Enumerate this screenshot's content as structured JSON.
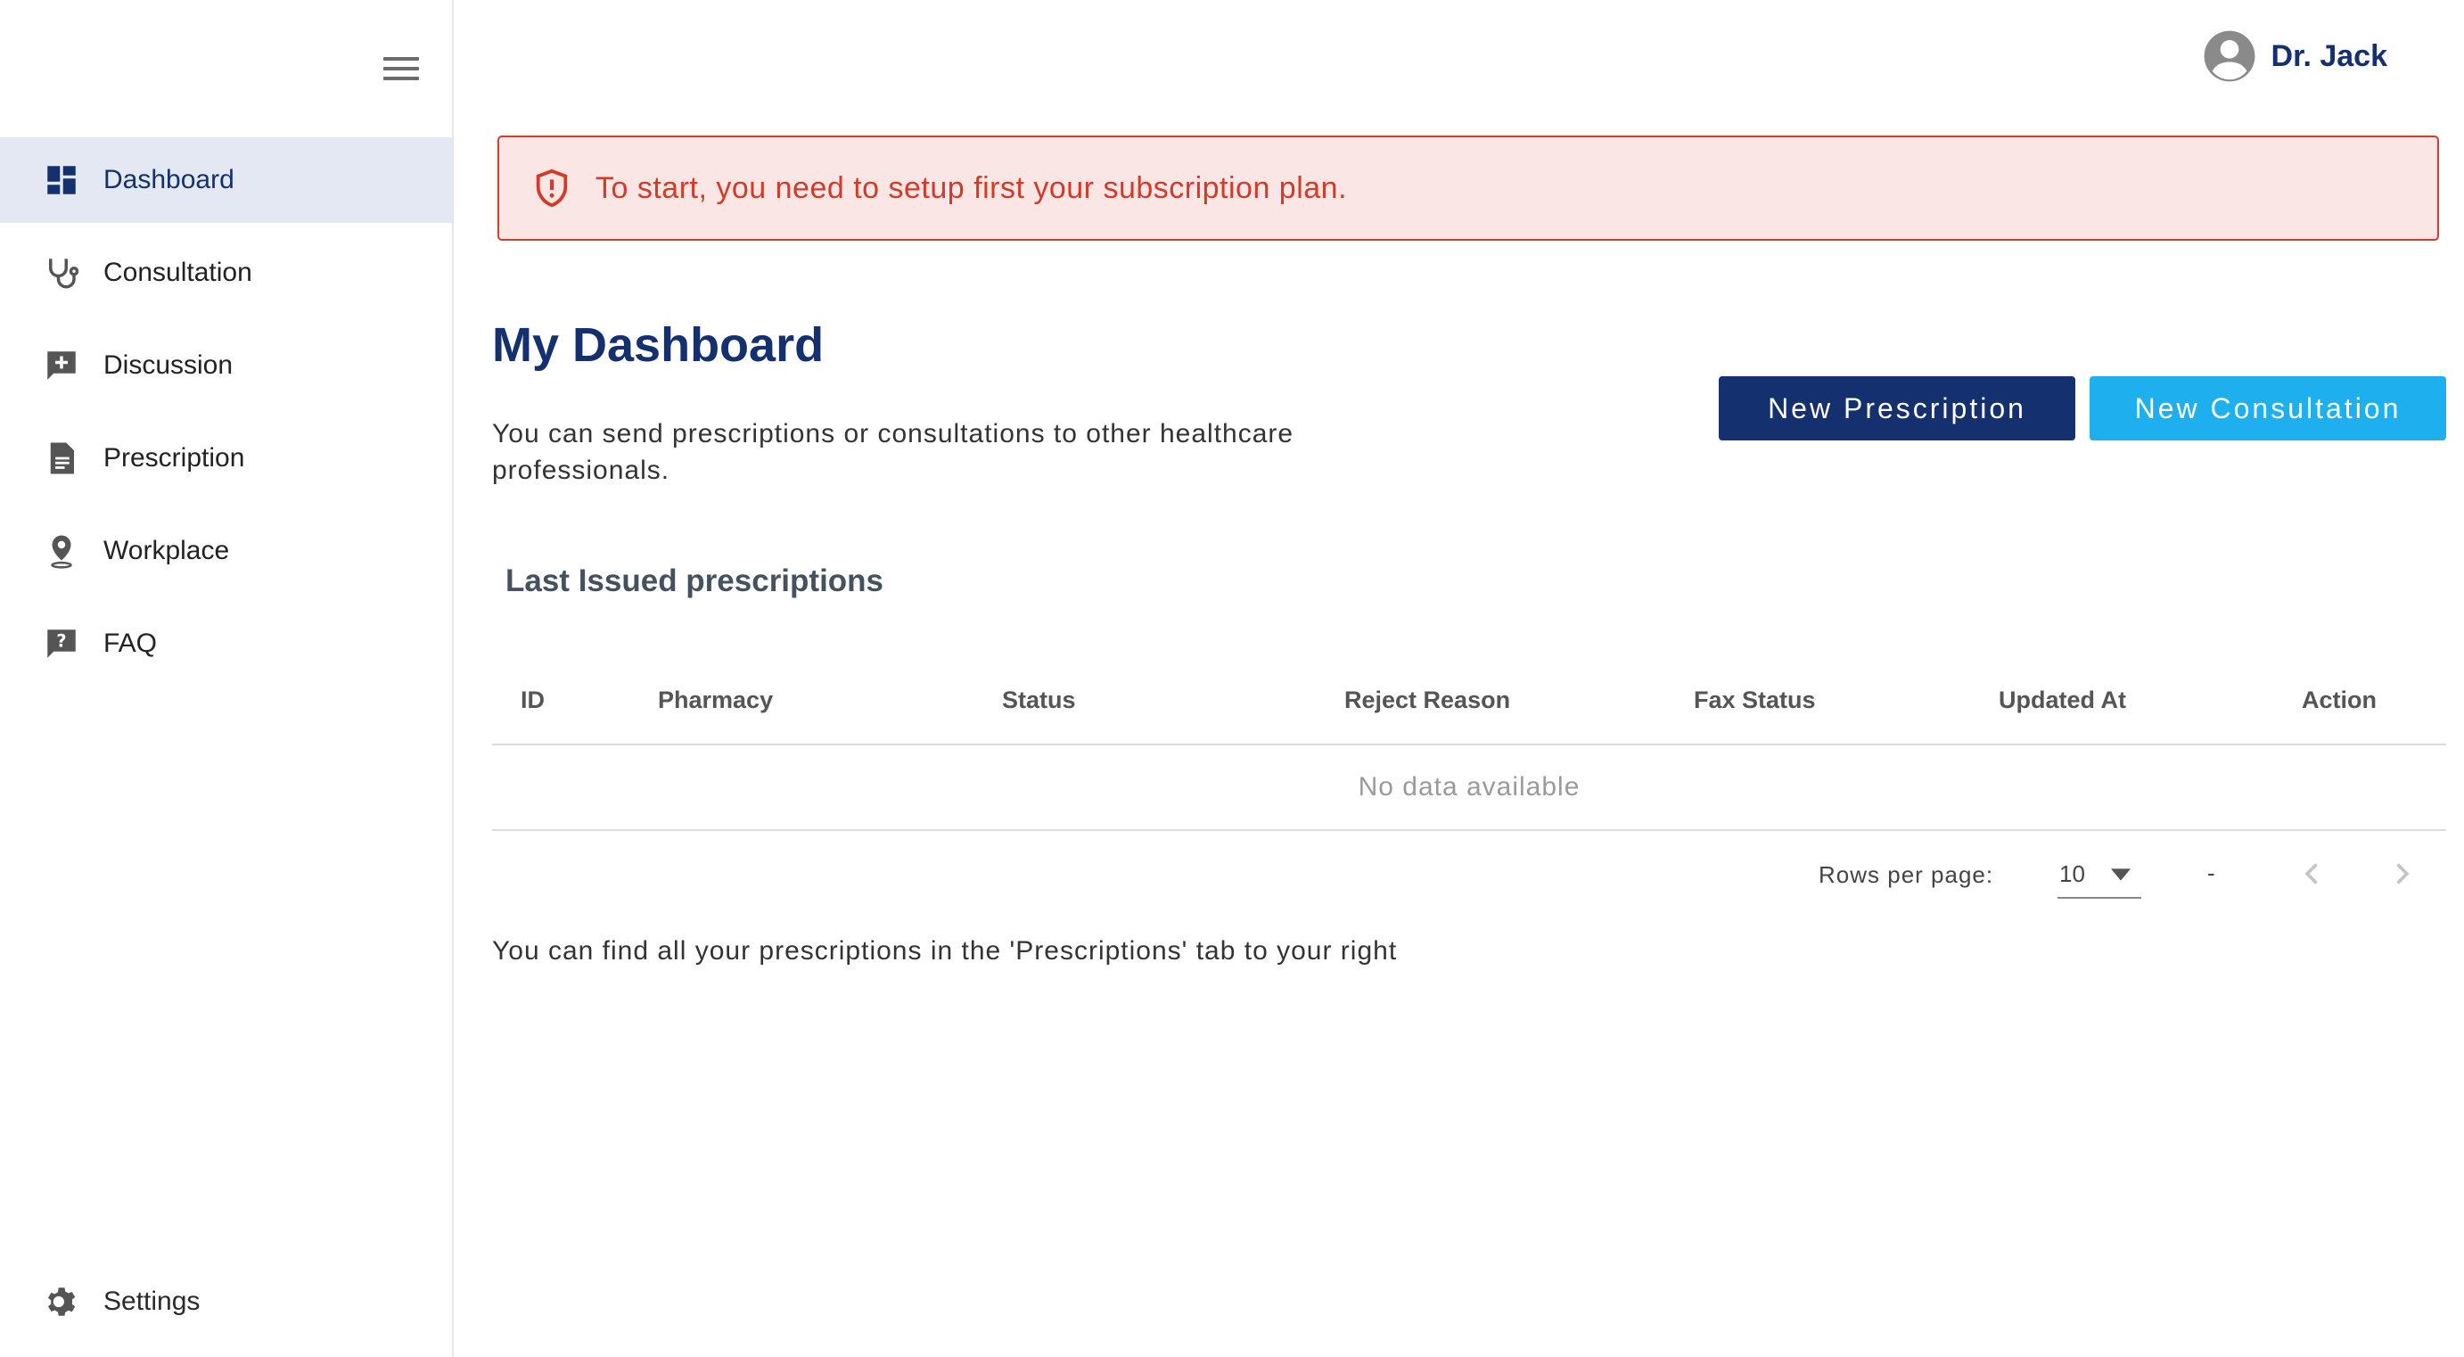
{
  "sidebar": {
    "items": [
      {
        "label": "Dashboard",
        "icon": "dashboard-icon",
        "active": true
      },
      {
        "label": "Consultation",
        "icon": "stethoscope-icon"
      },
      {
        "label": "Discussion",
        "icon": "chat-add-icon"
      },
      {
        "label": "Prescription",
        "icon": "document-icon"
      },
      {
        "label": "Workplace",
        "icon": "location-pin-icon"
      },
      {
        "label": "FAQ",
        "icon": "help-icon"
      }
    ],
    "settings_label": "Settings"
  },
  "header": {
    "user_name": "Dr. Jack"
  },
  "alert": {
    "text": "To start, you need to setup first your subscription plan.",
    "color": "#d33a28"
  },
  "main": {
    "title": "My Dashboard",
    "subtitle": "You can send prescriptions or consultations to other healthcare professionals.",
    "new_prescription": "New Prescription",
    "new_consultation": "New Consultation",
    "section_title": "Last Issued prescriptions",
    "table": {
      "columns": [
        "ID",
        "Pharmacy",
        "Status",
        "Reject Reason",
        "Fax Status",
        "Updated At",
        "Action"
      ],
      "empty_text": "No data available",
      "rows_per_page_label": "Rows per page:",
      "rows_per_page_value": "10",
      "page_range": "-"
    },
    "hint": "You can find all your prescriptions in the 'Prescriptions' tab to your right"
  },
  "colors": {
    "brand": "#14306e",
    "accent": "#1eb0ee",
    "active_bg": "#e3e8f2"
  }
}
